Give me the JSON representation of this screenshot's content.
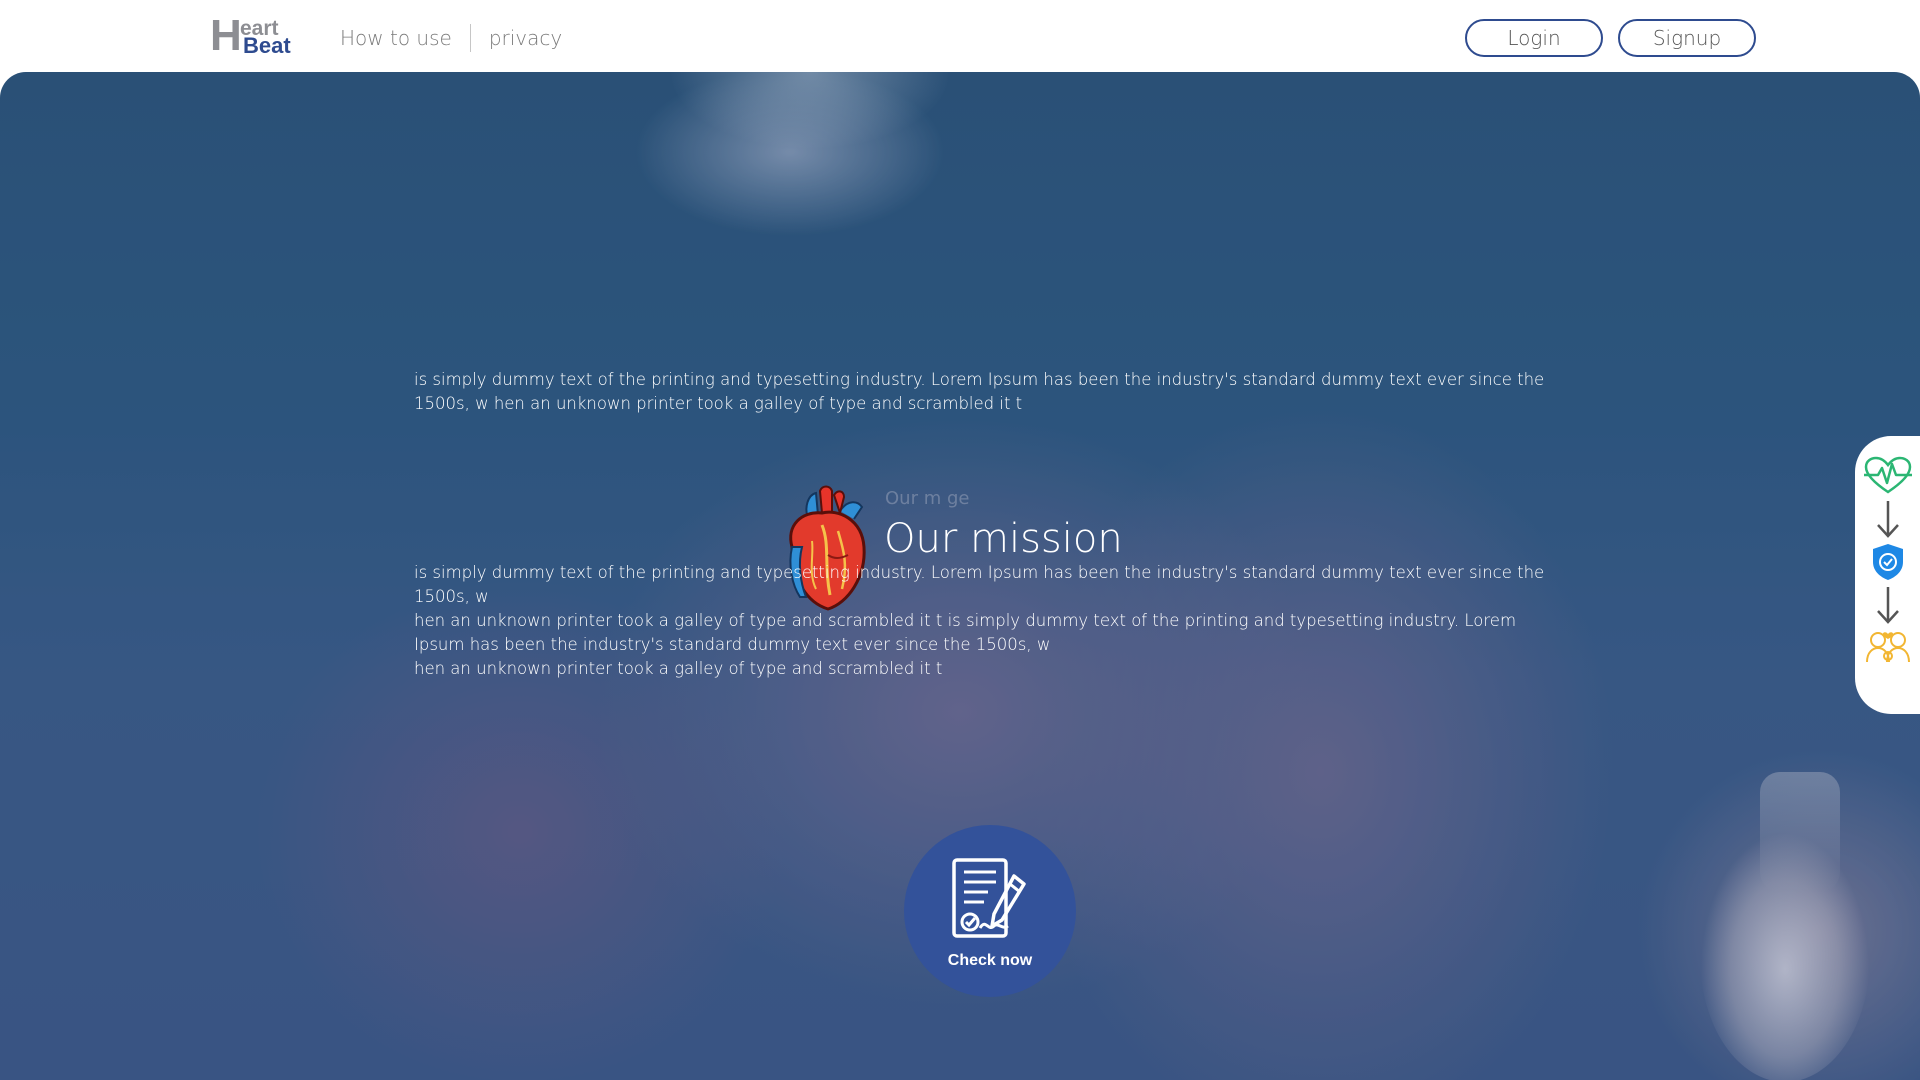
{
  "brand": {
    "logo_h": "H",
    "logo_eart": "eart",
    "logo_beat": "Beat"
  },
  "nav": {
    "items": [
      {
        "label": "How to use"
      },
      {
        "label": "privacy"
      }
    ]
  },
  "auth": {
    "login_label": "Login",
    "signup_label": "Signup"
  },
  "hero": {
    "para_1": " is simply dummy text of the printing and typesetting industry. Lorem Ipsum has been the industry's standard dummy text ever since the 1500s, w hen an unknown printer took a galley of type and scrambled it t",
    "mission_title": "Our mission",
    "faint_label": "Our m ge",
    "para_2_lines": [
      " is simply dummy text of the printing and typesetting industry. Lorem Ipsum has been the industry's standard dummy text ever since the 1500s, w",
      "hen an unknown printer took a galley of type and scrambled it t is simply dummy text of the printing and typesetting industry. Lorem",
      "Ipsum has been the industry's standard dummy text ever since the 1500s, w",
      "hen an unknown printer took a galley of type and scrambled it t"
    ],
    "check_label": "Check now"
  },
  "side_steps": {
    "icons": [
      "heartbeat-icon",
      "arrow-down-icon",
      "shield-check-icon",
      "arrow-down-icon",
      "family-icon"
    ]
  },
  "colors": {
    "brand_blue": "#2e4b8f",
    "button_blue": "#33529a",
    "pulse_green": "#2bb673",
    "shield_blue": "#1e88e5",
    "family_gold": "#f2b632"
  }
}
